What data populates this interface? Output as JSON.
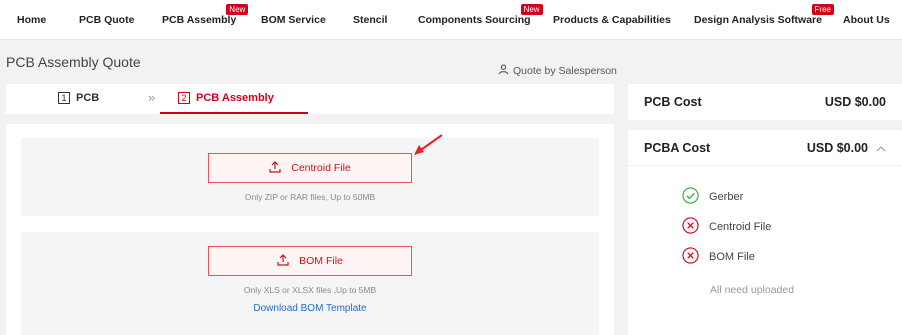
{
  "nav": {
    "items": [
      {
        "label": "Home"
      },
      {
        "label": "PCB Quote"
      },
      {
        "label": "PCB Assembly",
        "badge": "New"
      },
      {
        "label": "BOM Service"
      },
      {
        "label": "Stencil"
      },
      {
        "label": "Components Sourcing",
        "badge": "New"
      },
      {
        "label": "Products & Capabilities"
      },
      {
        "label": "Design Analysis Software",
        "badge": "Free"
      },
      {
        "label": "About Us"
      }
    ]
  },
  "page": {
    "title": "PCB Assembly Quote",
    "quote_by_salesperson": "Quote by Salesperson"
  },
  "steps": [
    {
      "num": "1",
      "label": "PCB"
    },
    {
      "num": "2",
      "label": "PCB Assembly"
    }
  ],
  "centroid": {
    "button_label": "Centroid File",
    "hint": "Only ZIP or RAR files, Up to 50MB"
  },
  "bom": {
    "button_label": "BOM File",
    "hint": "Only XLS or XLSX files ,Up to 5MB",
    "template_link": "Download BOM Template"
  },
  "summary": {
    "pcb_cost_label": "PCB Cost",
    "pcb_cost_value": "USD $0.00",
    "pcba_cost_label": "PCBA Cost",
    "pcba_cost_value": "USD $0.00",
    "files": [
      {
        "label": "Gerber",
        "status": "ok"
      },
      {
        "label": "Centroid File",
        "status": "missing"
      },
      {
        "label": "BOM File",
        "status": "missing"
      }
    ],
    "all_need_uploaded": "All need uploaded"
  },
  "colors": {
    "accent": "#d0021b",
    "ok": "#2aa845",
    "link": "#1f6fd0"
  }
}
